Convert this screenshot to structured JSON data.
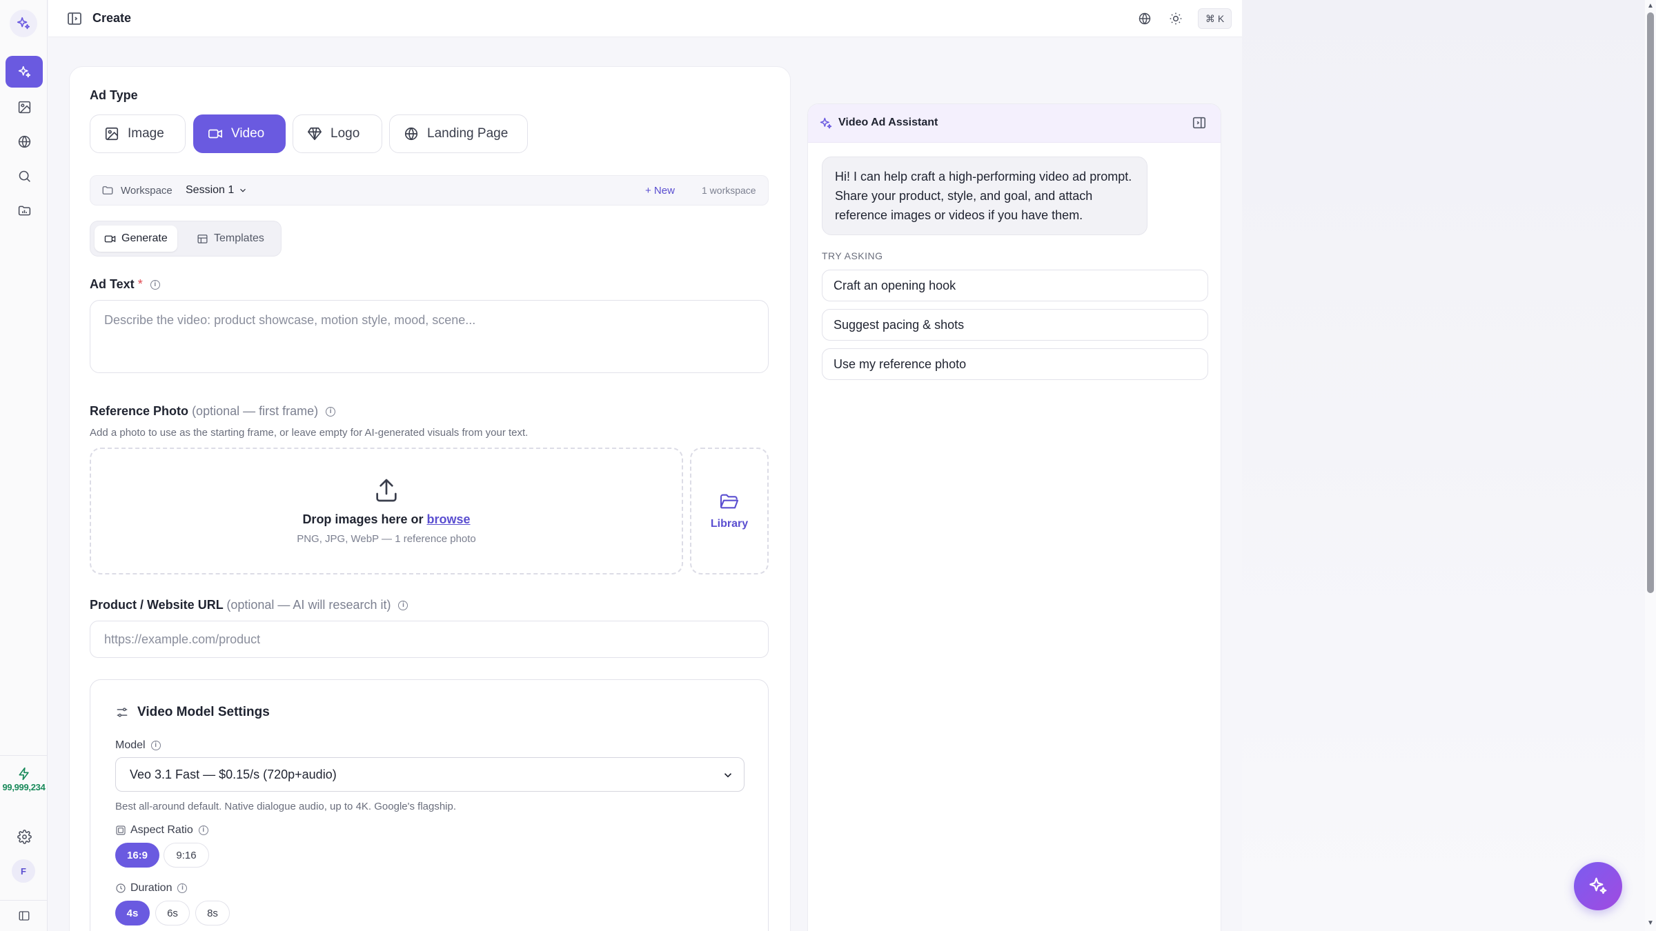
{
  "topbar": {
    "title": "Create",
    "shortcut": "⌘ K"
  },
  "sidebar": {
    "credits": "99,999,234",
    "avatar_initial": "F"
  },
  "ad_type": {
    "label": "Ad Type",
    "options": [
      {
        "label": "Image",
        "icon": "image-icon",
        "active": false
      },
      {
        "label": "Video",
        "icon": "video-icon",
        "active": true
      },
      {
        "label": "Logo",
        "icon": "diamond-icon",
        "active": false
      },
      {
        "label": "Landing Page",
        "icon": "globe-icon",
        "active": false
      }
    ]
  },
  "workspace": {
    "label": "Workspace",
    "session": "Session 1",
    "new_label": "+ New",
    "count": "1 workspace"
  },
  "mode_tabs": {
    "generate": "Generate",
    "templates": "Templates"
  },
  "ad_text": {
    "label": "Ad Text",
    "required_mark": "*",
    "placeholder": "Describe the video: product showcase, motion style, mood, scene..."
  },
  "reference_photo": {
    "label": "Reference Photo",
    "hint": "(optional — first frame)",
    "helper": "Add a photo to use as the starting frame, or leave empty for AI-generated visuals from your text.",
    "drop_text": "Drop images here or",
    "browse": "browse",
    "formats": "PNG, JPG, WebP — 1 reference photo",
    "library": "Library"
  },
  "product_url": {
    "label": "Product / Website URL",
    "hint": "(optional — AI will research it)",
    "placeholder": "https://example.com/product"
  },
  "video_settings": {
    "title": "Video Model Settings",
    "model_label": "Model",
    "model_value": "Veo 3.1 Fast — $0.15/s (720p+audio)",
    "model_help": "Best all-around default. Native dialogue audio, up to 4K. Google's flagship.",
    "aspect_label": "Aspect Ratio",
    "aspect_options": [
      "16:9",
      "9:16"
    ],
    "aspect_selected": "16:9",
    "duration_label": "Duration",
    "duration_options": [
      "4s",
      "6s",
      "8s"
    ],
    "duration_selected": "4s"
  },
  "assistant": {
    "title": "Video Ad Assistant",
    "greeting": "Hi! I can help craft a high-performing video ad prompt. Share your product, style, and goal, and attach reference images or videos if you have them.",
    "try_label": "TRY ASKING",
    "suggestions": [
      "Craft an opening hook",
      "Suggest pacing & shots",
      "Use my reference photo"
    ]
  },
  "colors": {
    "accent": "#6a5ae0",
    "credits": "#1a8a5b"
  }
}
